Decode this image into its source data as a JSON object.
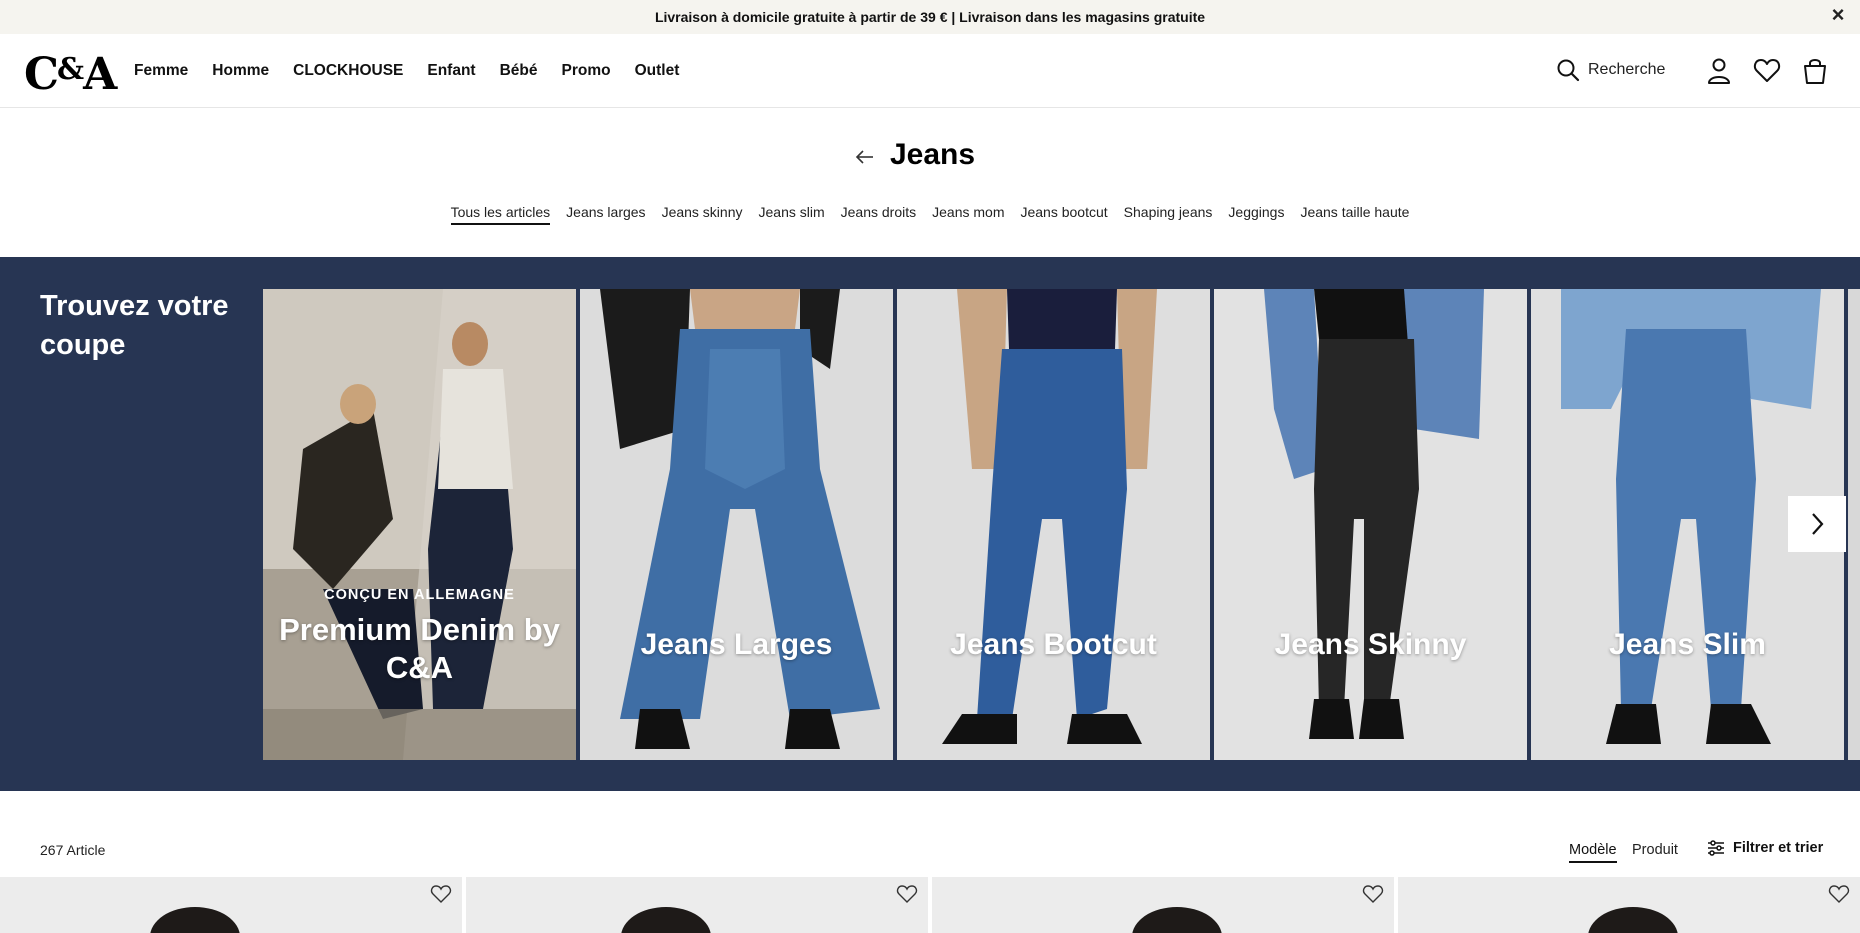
{
  "promo": {
    "text": "Livraison à domicile gratuite à partir de 39 € | Livraison dans les magasins gratuite",
    "close_icon": "close-icon"
  },
  "header": {
    "logo": "C&A",
    "nav": [
      "Femme",
      "Homme",
      "CLOCKHOUSE",
      "Enfant",
      "Bébé",
      "Promo",
      "Outlet"
    ],
    "search_label": "Recherche",
    "icons": [
      "search-icon",
      "user-icon",
      "heart-icon",
      "bag-icon"
    ]
  },
  "category": {
    "title": "Jeans",
    "back_icon": "arrow-left-icon",
    "subcategories": [
      "Tous les articles",
      "Jeans larges",
      "Jeans skinny",
      "Jeans slim",
      "Jeans droits",
      "Jeans mom",
      "Jeans bootcut",
      "Shaping jeans",
      "Jeggings",
      "Jeans taille haute"
    ],
    "active_subcategory": "Tous les articles"
  },
  "hero": {
    "title": "Trouvez votre coupe",
    "background_color": "#273553",
    "cards": [
      {
        "kicker": "CONÇU EN ALLEMAGNE",
        "label": "Premium Denim by C&A"
      },
      {
        "label": "Jeans Larges"
      },
      {
        "label": "Jeans Bootcut"
      },
      {
        "label": "Jeans Skinny"
      },
      {
        "label": "Jeans Slim"
      }
    ],
    "next_icon": "chevron-right-icon"
  },
  "listing": {
    "count": "267 Article",
    "view_model": "Modèle",
    "view_product": "Produit",
    "filter_label": "Filtrer et trier",
    "filter_icon": "sliders-icon",
    "tile_icon": "heart-outline-icon"
  }
}
